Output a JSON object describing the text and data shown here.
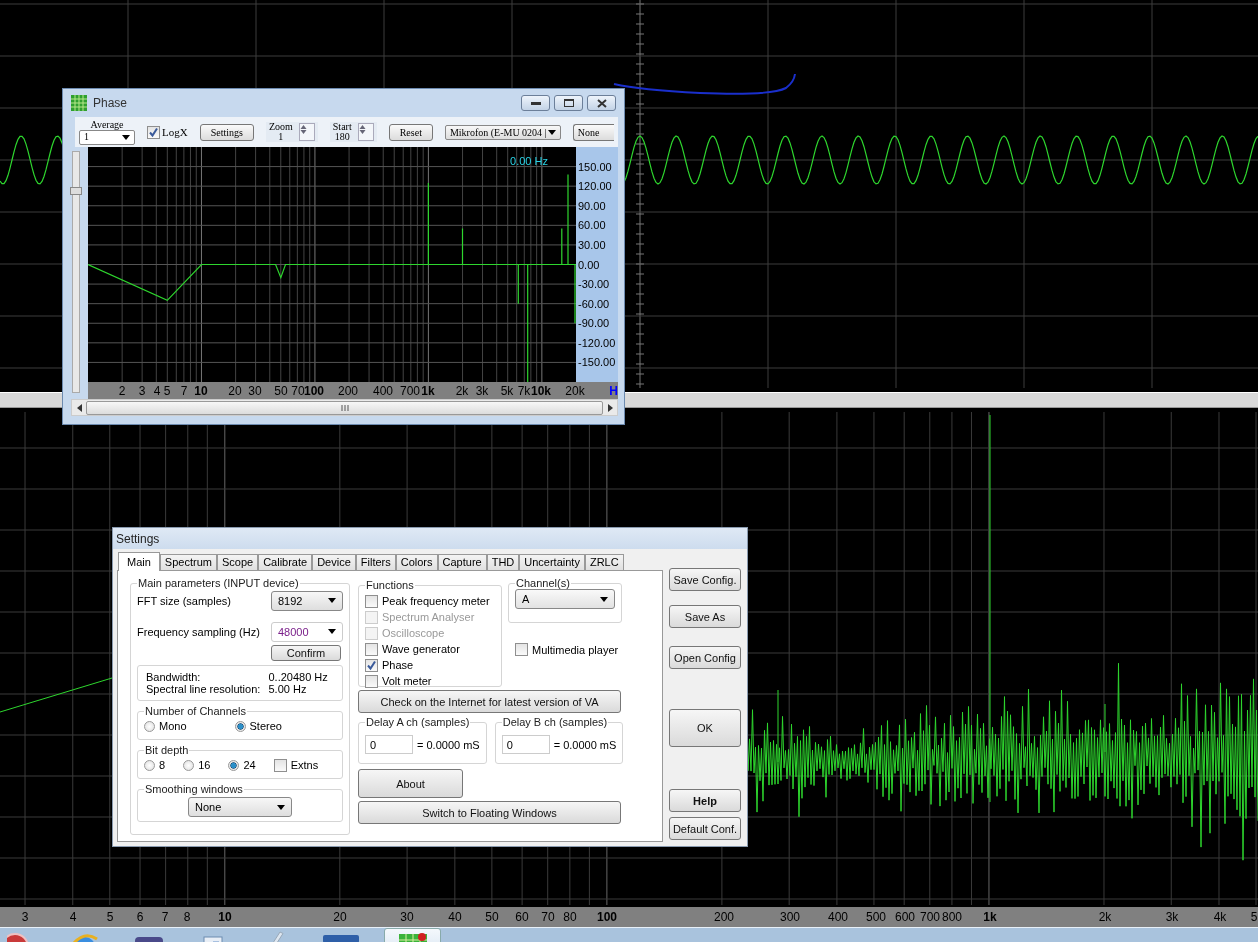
{
  "spectrum": {
    "axis_labels": [
      {
        "label": "3",
        "emphasized": false
      },
      {
        "label": "4",
        "emphasized": false
      },
      {
        "label": "5",
        "emphasized": false
      },
      {
        "label": "6",
        "emphasized": false
      },
      {
        "label": "7",
        "emphasized": false
      },
      {
        "label": "8",
        "emphasized": false
      },
      {
        "label": "10",
        "emphasized": true
      },
      {
        "label": "20",
        "emphasized": false
      },
      {
        "label": "30",
        "emphasized": false
      },
      {
        "label": "40",
        "emphasized": false
      },
      {
        "label": "50",
        "emphasized": false
      },
      {
        "label": "60",
        "emphasized": false
      },
      {
        "label": "70",
        "emphasized": false
      },
      {
        "label": "80",
        "emphasized": false
      },
      {
        "label": "100",
        "emphasized": true
      },
      {
        "label": "200",
        "emphasized": false
      },
      {
        "label": "300",
        "emphasized": false
      },
      {
        "label": "400",
        "emphasized": false
      },
      {
        "label": "500",
        "emphasized": false
      },
      {
        "label": "600",
        "emphasized": false
      },
      {
        "label": "700",
        "emphasized": false
      },
      {
        "label": "800",
        "emphasized": false
      },
      {
        "label": "1k",
        "emphasized": true
      },
      {
        "label": "2k",
        "emphasized": false
      },
      {
        "label": "3k",
        "emphasized": false
      },
      {
        "label": "4k",
        "emphasized": false
      },
      {
        "label": "5",
        "emphasized": false
      }
    ]
  },
  "phase_window": {
    "title": "Phase",
    "toolbar": {
      "average": {
        "label": "Average",
        "value": "1"
      },
      "logx": {
        "label": "LogX",
        "checked": true
      },
      "settings_button": "Settings",
      "zoom": {
        "label": "Zoom",
        "value": "1"
      },
      "start": {
        "label": "Start",
        "value": "180"
      },
      "reset_button": "Reset",
      "device": {
        "value": "Mikrofon (E-MU 0204 |"
      },
      "none_button": "None"
    },
    "vertical_slider": {
      "level": 0.85
    },
    "marker_readout": "0.00 Hz",
    "x_axis_unit": "H",
    "x_axis_labels": [
      {
        "label": "2",
        "emphasized": false
      },
      {
        "label": "3",
        "emphasized": false
      },
      {
        "label": "4",
        "emphasized": false
      },
      {
        "label": "5",
        "emphasized": false
      },
      {
        "label": "7",
        "emphasized": false
      },
      {
        "label": "10",
        "emphasized": true
      },
      {
        "label": "20",
        "emphasized": false
      },
      {
        "label": "30",
        "emphasized": false
      },
      {
        "label": "50",
        "emphasized": false
      },
      {
        "label": "70",
        "emphasized": false
      },
      {
        "label": "100",
        "emphasized": true
      },
      {
        "label": "200",
        "emphasized": false
      },
      {
        "label": "400",
        "emphasized": false
      },
      {
        "label": "700",
        "emphasized": false
      },
      {
        "label": "1k",
        "emphasized": true
      },
      {
        "label": "2k",
        "emphasized": false
      },
      {
        "label": "3k",
        "emphasized": false
      },
      {
        "label": "5k",
        "emphasized": false
      },
      {
        "label": "7k",
        "emphasized": false
      },
      {
        "label": "10k",
        "emphasized": true
      },
      {
        "label": "20k",
        "emphasized": false
      }
    ],
    "y_axis_labels": [
      "150.00",
      "120.00",
      "90.00",
      "60.00",
      "30.00",
      "0.00",
      "-30.00",
      "-60.00",
      "-90.00",
      "-120.00",
      "-150.00"
    ]
  },
  "settings_dialog": {
    "title": "Settings",
    "tabs": [
      {
        "label": "Main",
        "selected": true
      },
      {
        "label": "Spectrum",
        "selected": false
      },
      {
        "label": "Scope",
        "selected": false
      },
      {
        "label": "Calibrate",
        "selected": false
      },
      {
        "label": "Device",
        "selected": false
      },
      {
        "label": "Filters",
        "selected": false
      },
      {
        "label": "Colors",
        "selected": false
      },
      {
        "label": "Capture",
        "selected": false
      },
      {
        "label": "THD",
        "selected": false
      },
      {
        "label": "Uncertainty",
        "selected": false
      },
      {
        "label": "ZRLC",
        "selected": false
      }
    ],
    "main_parameters": {
      "title": "Main parameters (INPUT device)",
      "fft_size": {
        "label": "FFT size (samples)",
        "value": "8192"
      },
      "frequency_sampling": {
        "label": "Frequency sampling (Hz)",
        "value": "48000"
      },
      "confirm_button": "Confirm",
      "bandwidth": {
        "label": "Bandwidth:",
        "value": "0..20480 Hz"
      },
      "resolution": {
        "label": "Spectral line resolution:",
        "value": "5.00 Hz"
      }
    },
    "channels_group": {
      "title": "Number of Channels",
      "options": [
        {
          "label": "Mono",
          "selected": false
        },
        {
          "label": "Stereo",
          "selected": true
        }
      ]
    },
    "bit_depth": {
      "title": "Bit depth",
      "options": [
        {
          "label": "8",
          "selected": false
        },
        {
          "label": "16",
          "selected": false
        },
        {
          "label": "24",
          "selected": true
        }
      ],
      "extns": {
        "label": "Extns",
        "checked": false
      }
    },
    "smoothing": {
      "title": "Smoothing windows",
      "value": "None"
    },
    "functions": {
      "title": "Functions",
      "items": [
        {
          "label": "Peak frequency meter",
          "checked": false,
          "disabled": false
        },
        {
          "label": "Spectrum Analyser",
          "checked": false,
          "disabled": true
        },
        {
          "label": "Oscilloscope",
          "checked": false,
          "disabled": true
        },
        {
          "label": "Wave generator",
          "checked": false,
          "disabled": false
        },
        {
          "label": "Phase",
          "checked": true,
          "disabled": false
        },
        {
          "label": "Volt meter",
          "checked": false,
          "disabled": false
        }
      ]
    },
    "channel_select": {
      "title": "Channel(s)",
      "value": "A"
    },
    "multimedia_player": {
      "label": "Multimedia player",
      "checked": false
    },
    "check_button": "Check on the Internet for latest version of VA",
    "delays": [
      {
        "title": "Delay A ch (samples)",
        "value": "0",
        "result": "= 0.0000 mS"
      },
      {
        "title": "Delay B ch (samples)",
        "value": "0",
        "result": "= 0.0000 mS"
      }
    ],
    "about_button": "About",
    "floating_button": "Switch to Floating Windows",
    "side_buttons": [
      {
        "label": "Save Config.",
        "kind": "normal"
      },
      {
        "label": "Save As",
        "kind": "normal"
      },
      {
        "label": "Open Config",
        "kind": "normal"
      },
      {
        "label": "OK",
        "kind": "tall"
      },
      {
        "label": "Help",
        "kind": "bold"
      },
      {
        "label": "Default Conf.",
        "kind": "normal"
      }
    ]
  },
  "taskbar": {
    "buttons": [
      {
        "kind": "orb",
        "selected": false
      },
      {
        "kind": "globe",
        "selected": false
      },
      {
        "kind": "app",
        "selected": false
      },
      {
        "kind": "window",
        "selected": false
      },
      {
        "kind": "pen",
        "selected": false
      },
      {
        "kind": "bars",
        "selected": false
      },
      {
        "kind": "grid",
        "selected": true
      }
    ]
  }
}
